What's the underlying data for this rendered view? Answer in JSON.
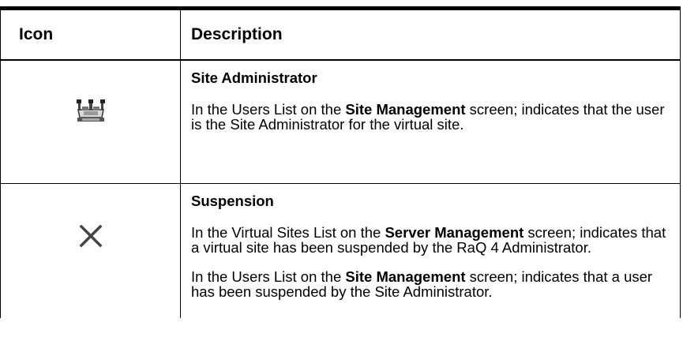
{
  "table": {
    "headers": {
      "icon": "Icon",
      "description": "Description"
    },
    "rows": [
      {
        "icon": "site-admin-crown-icon",
        "title": "Site Administrator",
        "paragraphs": [
          {
            "pre": "In the Users List on the ",
            "bold": "Site Management",
            "post": " screen; indicates that the user is the Site Administrator for the virtual site."
          }
        ]
      },
      {
        "icon": "suspension-x-icon",
        "title": "Suspension",
        "paragraphs": [
          {
            "pre": "In the Virtual Sites List on the ",
            "bold": "Server Management",
            "post": " screen; indicates that a virtual site has been suspended by the RaQ 4 Administrator."
          },
          {
            "pre": "In the Users List on the ",
            "bold": "Site Management",
            "post": " screen; indicates that a user has been suspended by the Site Administrator."
          }
        ]
      }
    ]
  }
}
